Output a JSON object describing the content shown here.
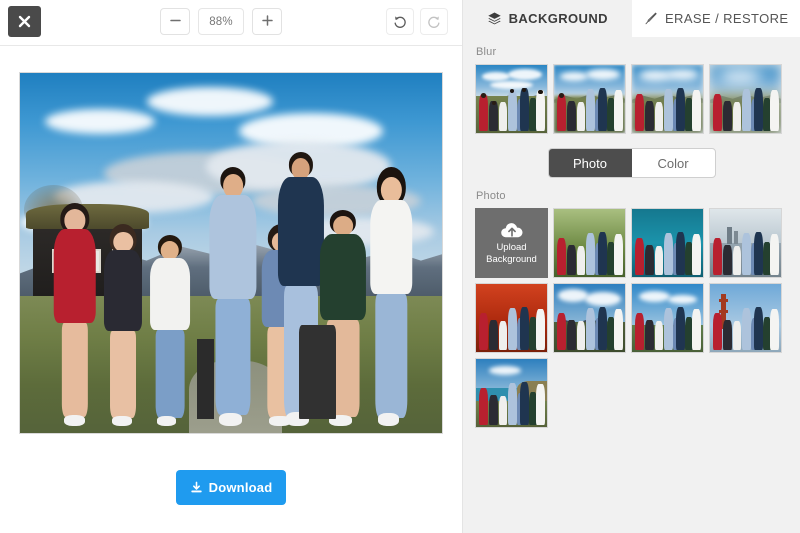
{
  "toolbar": {
    "close_label": "×",
    "close_icon": "close-icon",
    "zoom_out_label": "−",
    "zoom_out_icon": "minus-icon",
    "zoom_value": "88%",
    "zoom_in_label": "+",
    "zoom_in_icon": "plus-icon",
    "undo_icon": "undo-icon",
    "redo_icon": "redo-icon"
  },
  "editor": {
    "download_label": "Download",
    "download_icon": "download-icon",
    "download_color": "#1f9bef",
    "image_alt": "group photo of nine people outdoors with mountain and cabin background"
  },
  "panel": {
    "tabs": [
      {
        "label": "BACKGROUND",
        "icon": "layers-icon",
        "active": true
      },
      {
        "label": "ERASE / RESTORE",
        "icon": "brush-icon",
        "active": false
      }
    ],
    "blur": {
      "label": "Blur",
      "options": [
        {
          "name": "blur-none",
          "level": 0,
          "selected": true
        },
        {
          "name": "blur-light",
          "level": 1,
          "selected": false
        },
        {
          "name": "blur-medium",
          "level": 2,
          "selected": false
        },
        {
          "name": "blur-strong",
          "level": 3,
          "selected": false
        }
      ]
    },
    "source_toggle": {
      "photo_label": "Photo",
      "color_label": "Color",
      "selected": "Photo"
    },
    "photo": {
      "label": "Photo",
      "upload_tile": {
        "line1": "Upload",
        "line2": "Background",
        "icon": "cloud-upload-icon"
      },
      "options": [
        {
          "name": "bg-forest",
          "sky": "#9db77a",
          "mid": "#6e8a44",
          "ground": "#4e6630"
        },
        {
          "name": "bg-teal",
          "sky": "#1b7f96",
          "mid": "#1d8ea6",
          "ground": "#176273"
        },
        {
          "name": "bg-city",
          "sky": "#c5d2da",
          "mid": "#8fa2ae",
          "ground": "#6e7d88"
        },
        {
          "name": "bg-autumn",
          "sky": "#c2331a",
          "mid": "#a8280f",
          "ground": "#7d2510"
        },
        {
          "name": "bg-clouds",
          "sky": "#3f86bf",
          "mid": "#8fb6d4",
          "ground": "#4c5a3a"
        },
        {
          "name": "bg-beach-sky",
          "sky": "#2f88c9",
          "mid": "#7fb4d9",
          "ground": "#5f7a4a"
        },
        {
          "name": "bg-bridge",
          "sky": "#5fa3d6",
          "mid": "#8cbde0",
          "ground": "#7e9ab0"
        },
        {
          "name": "bg-coast",
          "sky": "#2d7fbe",
          "mid": "#2f8fae",
          "ground": "#6e7d4a"
        }
      ]
    }
  }
}
